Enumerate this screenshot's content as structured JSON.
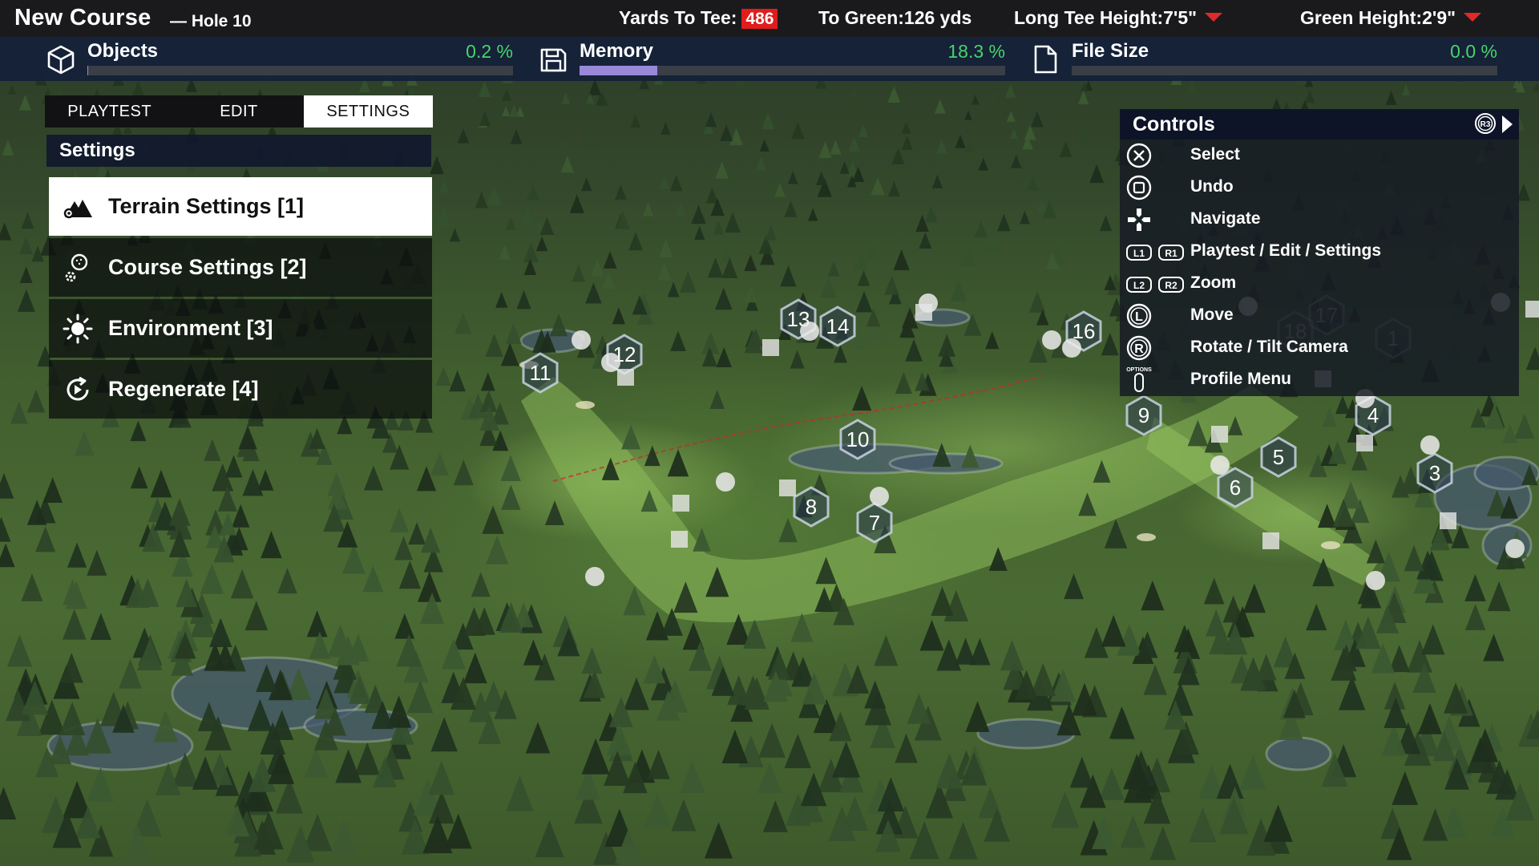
{
  "header": {
    "course_title": "New Course",
    "hole": "— Hole 10",
    "yards_to_tee_label": "Yards To Tee:",
    "yards_to_tee_value": "486",
    "to_green": "To Green:126 yds",
    "long_tee_height": "Long Tee Height:7'5\"",
    "green_height": "Green Height:2'9\""
  },
  "metrics": [
    {
      "label": "Objects",
      "value": "0.2 %",
      "fraction": 0.002,
      "icon": "cube-icon"
    },
    {
      "label": "Memory",
      "value": "18.3 %",
      "fraction": 0.183,
      "icon": "floppy-disk-icon"
    },
    {
      "label": "File Size",
      "value": "0.0 %",
      "fraction": 0.0,
      "icon": "file-icon"
    }
  ],
  "tabs": [
    {
      "label": "PLAYTEST",
      "active": false
    },
    {
      "label": "EDIT",
      "active": false
    },
    {
      "label": "SETTINGS",
      "active": true
    }
  ],
  "settings": {
    "header": "Settings",
    "items": [
      {
        "label": "Terrain Settings [1]",
        "icon": "mountain-icon",
        "active": true
      },
      {
        "label": "Course Settings [2]",
        "icon": "golf-settings-icon",
        "active": false
      },
      {
        "label": "Environment [3]",
        "icon": "sun-icon",
        "active": false
      },
      {
        "label": "Regenerate [4]",
        "icon": "regenerate-icon",
        "active": false
      }
    ]
  },
  "controls": {
    "title": "Controls",
    "toggle_button": "R3",
    "rows": [
      {
        "buttons": [
          "X"
        ],
        "label": "Select"
      },
      {
        "buttons": [
          "□"
        ],
        "label": "Undo"
      },
      {
        "buttons": [
          "dpad"
        ],
        "label": "Navigate"
      },
      {
        "buttons": [
          "L1",
          "R1"
        ],
        "label": "Playtest / Edit / Settings"
      },
      {
        "buttons": [
          "L2",
          "R2"
        ],
        "label": "Zoom"
      },
      {
        "buttons": [
          "L"
        ],
        "label": "Move"
      },
      {
        "buttons": [
          "R"
        ],
        "label": "Rotate / Tilt Camera"
      },
      {
        "buttons": [
          "OPTIONS"
        ],
        "label": "Profile Menu"
      }
    ]
  },
  "holes": [
    {
      "n": "1",
      "faded": true
    },
    {
      "n": "3",
      "faded": false
    },
    {
      "n": "4",
      "faded": false
    },
    {
      "n": "5",
      "faded": false
    },
    {
      "n": "6",
      "faded": false
    },
    {
      "n": "7",
      "faded": false
    },
    {
      "n": "8",
      "faded": false
    },
    {
      "n": "9",
      "faded": false
    },
    {
      "n": "10",
      "faded": false
    },
    {
      "n": "11",
      "faded": false
    },
    {
      "n": "12",
      "faded": false
    },
    {
      "n": "13",
      "faded": false
    },
    {
      "n": "14",
      "faded": false
    },
    {
      "n": "16",
      "faded": false
    },
    {
      "n": "17",
      "faded": true
    },
    {
      "n": "18",
      "faded": true
    }
  ]
}
